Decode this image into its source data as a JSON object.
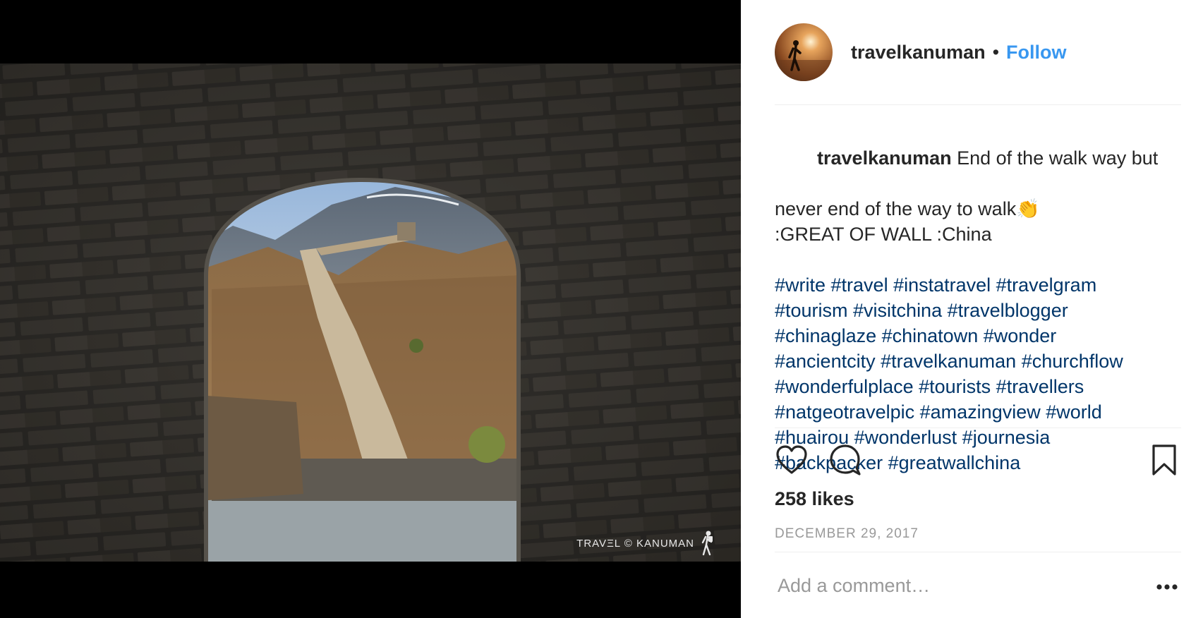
{
  "header": {
    "username": "travelkanuman",
    "separator": "•",
    "follow_label": "Follow"
  },
  "media": {
    "watermark": "TRAVΞL © KANUMAN"
  },
  "caption": {
    "username": "travelkanuman",
    "line1": " End of the walk way but",
    "line2": "never end of the way to walk👏",
    "line3": ":GREAT OF WALL :China",
    "hashtag_lines": [
      "#write #travel #instatravel #travelgram",
      "#tourism #visitchina #travelblogger",
      "#chinaglaze #chinatown #wonder",
      "#ancientcity #travelkanuman #churchflow",
      "#wonderfulplace #tourists #travellers",
      "#natgeotravelpic #amazingview #world",
      "#huairou #wonderlust #journesia",
      "#backpacker #greatwallchina"
    ]
  },
  "actions": {
    "icons": [
      "heart-icon",
      "comment-icon",
      "bookmark-icon"
    ]
  },
  "likes_text": "258 likes",
  "date_text": "DECEMBER 29, 2017",
  "comment": {
    "placeholder": "Add a comment…",
    "value": ""
  },
  "colors": {
    "follow": "#3897f0",
    "hashtag": "#003569",
    "muted": "#999999",
    "text": "#262626"
  }
}
